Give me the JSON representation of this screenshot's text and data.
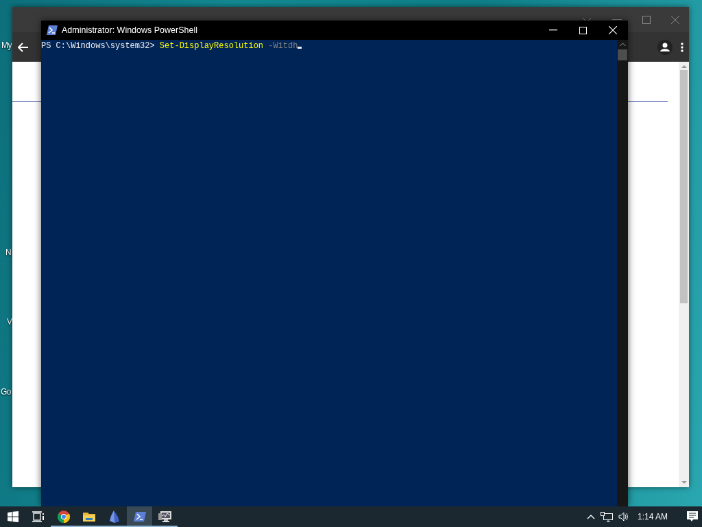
{
  "desktop": {
    "icon_labels": [
      {
        "label": "My"
      },
      {
        "label": "N"
      },
      {
        "label": "V"
      },
      {
        "label": "Go"
      }
    ]
  },
  "browser_window": {
    "active": false
  },
  "powershell_window": {
    "title": "Administrator: Windows PowerShell",
    "active": true,
    "console_lines": [
      {
        "segments": [
          {
            "kind": "prompt",
            "text": "PS C:\\Windows\\system32> "
          },
          {
            "kind": "command",
            "text": "Set-DisplayResolution"
          },
          {
            "kind": "parameter",
            "text": "-Witdh"
          }
        ],
        "cursor": true
      }
    ]
  },
  "taskbar": {
    "items": [
      {
        "kind": "start",
        "running": false,
        "selected": false
      },
      {
        "kind": "task-view",
        "running": false,
        "selected": false
      },
      {
        "kind": "browser",
        "running": true,
        "selected": false
      },
      {
        "kind": "folder",
        "running": true,
        "selected": false
      },
      {
        "kind": "crystal",
        "running": true,
        "selected": false
      },
      {
        "kind": "terminal",
        "running": true,
        "selected": true
      },
      {
        "kind": "monitor",
        "running": true,
        "selected": false
      }
    ],
    "tray": {
      "time": "1:14 AM"
    }
  }
}
